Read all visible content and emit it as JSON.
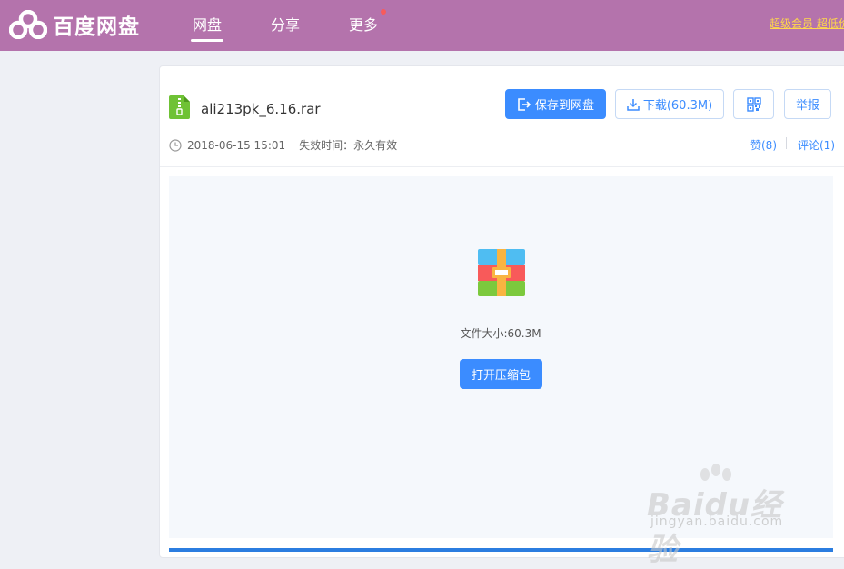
{
  "header": {
    "logo_text": "百度网盘",
    "nav": [
      {
        "label": "网盘",
        "active": true
      },
      {
        "label": "分享",
        "active": false
      },
      {
        "label": "更多",
        "active": false
      }
    ],
    "promo_text": "超级会员 超低价"
  },
  "file": {
    "name": "ali213pk_6.16.rar",
    "date": "2018-06-15 15:01",
    "expiry_label": "失效时间：永久有效",
    "likes": "赞(8)",
    "comments": "评论(1)"
  },
  "actions": {
    "save_label": "保存到网盘",
    "download_label": "下载(60.3M)",
    "report_label": "举报"
  },
  "preview": {
    "size_label": "文件大小:60.3M",
    "open_label": "打开压缩包"
  },
  "watermark": {
    "main": "Baidu经验",
    "sub": "jingyan.baidu.com"
  },
  "colors": {
    "header_bg": "#b473ac",
    "primary": "#3b8cff",
    "promo": "#ffd84a"
  }
}
